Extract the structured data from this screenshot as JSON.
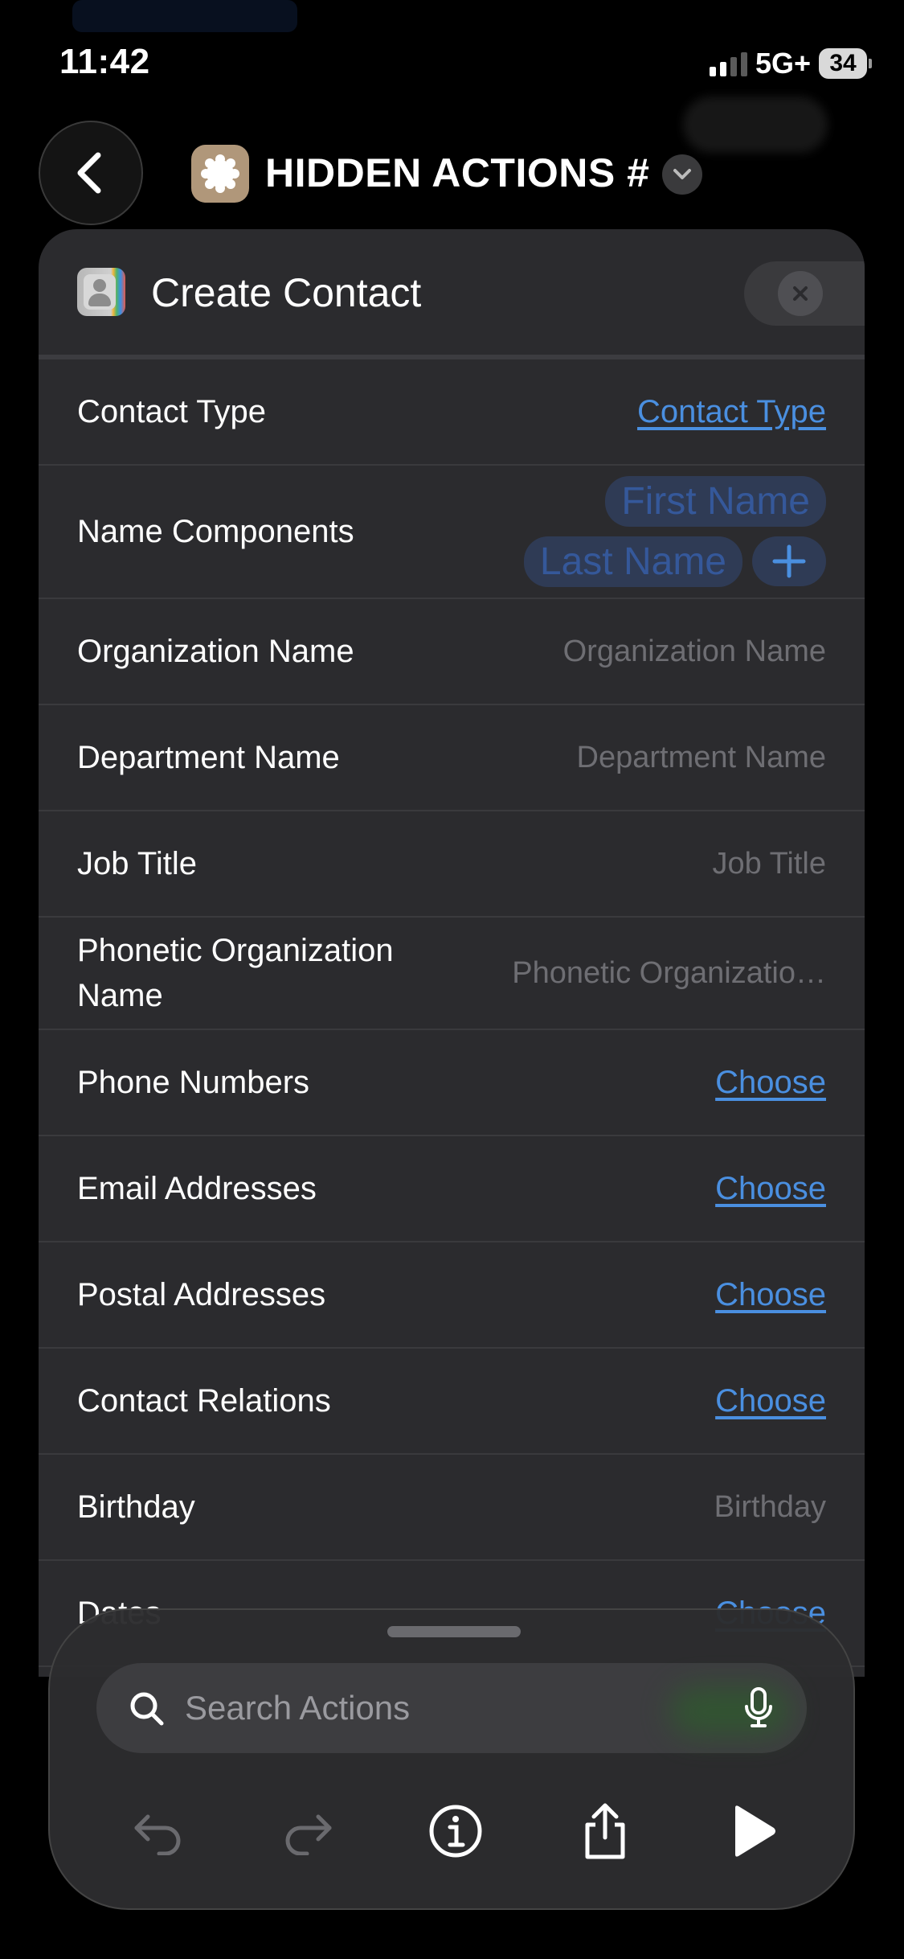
{
  "status_bar": {
    "time": "11:42",
    "network": "5G+",
    "battery": "34"
  },
  "nav": {
    "shortcut_title": "HIDDEN ACTIONS #"
  },
  "card": {
    "title": "Create Contact",
    "rows": [
      {
        "label": "Contact Type",
        "value": "Contact Type",
        "kind": "link"
      },
      {
        "label": "Name Components",
        "tokens": [
          "First Name",
          "Last Name"
        ],
        "kind": "tokens"
      },
      {
        "label": "Organization Name",
        "value": "Organization Name",
        "kind": "placeholder"
      },
      {
        "label": "Department Name",
        "value": "Department Name",
        "kind": "placeholder"
      },
      {
        "label": "Job Title",
        "value": "Job Title",
        "kind": "placeholder"
      },
      {
        "label": "Phonetic Organization Name",
        "value": "Phonetic Organizatio…",
        "kind": "placeholder"
      },
      {
        "label": "Phone Numbers",
        "value": "Choose",
        "kind": "link"
      },
      {
        "label": "Email Addresses",
        "value": "Choose",
        "kind": "link"
      },
      {
        "label": "Postal Addresses",
        "value": "Choose",
        "kind": "link"
      },
      {
        "label": "Contact Relations",
        "value": "Choose",
        "kind": "link"
      },
      {
        "label": "Birthday",
        "value": "Birthday",
        "kind": "placeholder"
      },
      {
        "label": "Dates",
        "value": "Choose",
        "kind": "link"
      }
    ]
  },
  "sheet": {
    "search_placeholder": "Search Actions"
  },
  "colors": {
    "accent": "#4a8fe0",
    "card_bg": "#2b2b2e",
    "token_bg": "#2f3b55"
  },
  "icons": [
    "back-chevron-icon",
    "shortcut-gear-icon",
    "chevron-down-icon",
    "contacts-app-icon",
    "close-icon",
    "plus-icon",
    "search-icon",
    "microphone-icon",
    "undo-icon",
    "redo-icon",
    "info-icon",
    "share-icon",
    "play-icon"
  ]
}
